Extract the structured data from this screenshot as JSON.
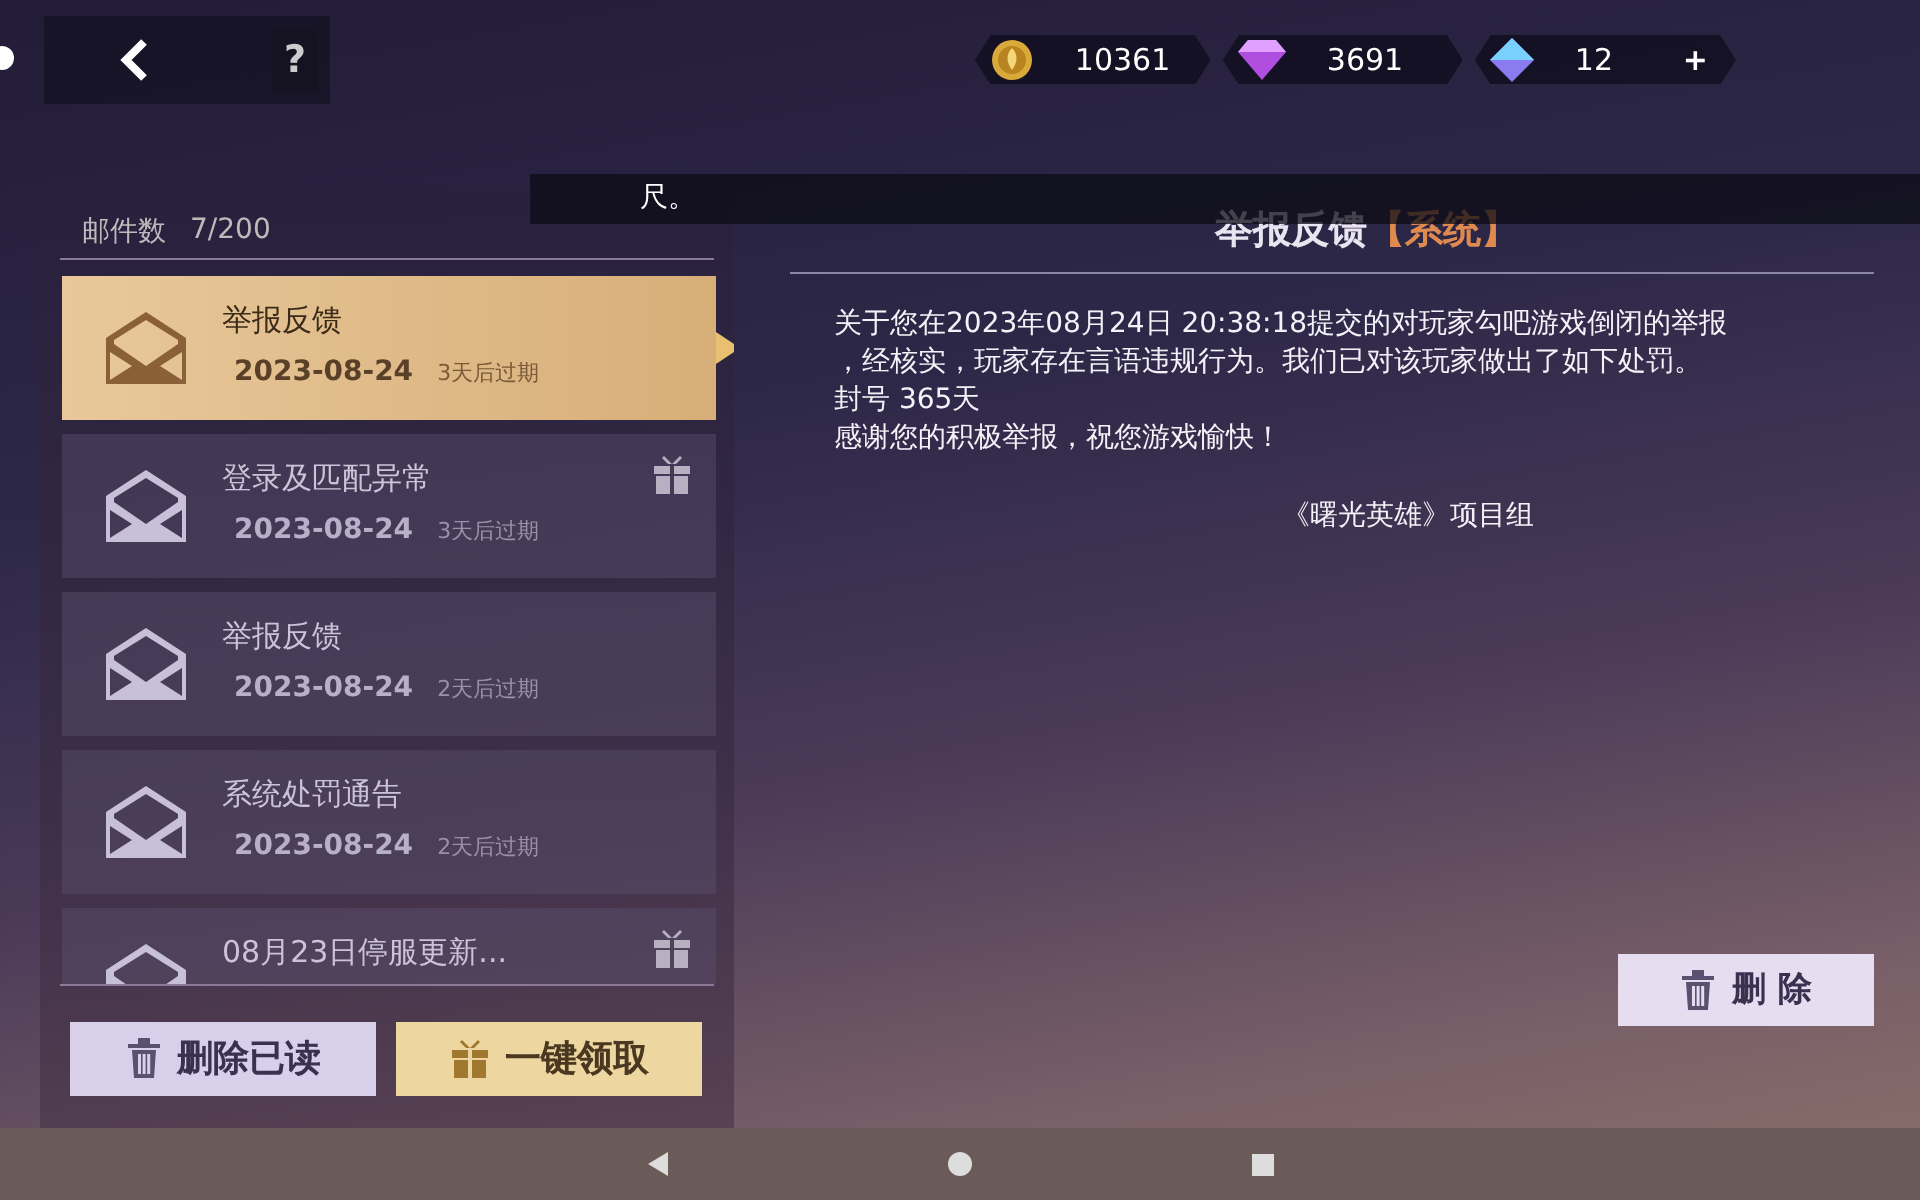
{
  "top_bar": {
    "help": "?",
    "currencies": [
      {
        "kind": "coin",
        "amount": "10361"
      },
      {
        "kind": "gem",
        "amount": "3691"
      },
      {
        "kind": "crystal",
        "amount": "12",
        "add": "+"
      }
    ]
  },
  "overlay_text": "尺。",
  "mail_panel": {
    "count_label": "邮件数",
    "count": "7/200",
    "mails": [
      {
        "title": "举报反馈",
        "date": "2023-08-24",
        "expiry": "3天后过期",
        "selected": true,
        "gift": false
      },
      {
        "title": "登录及匹配异常",
        "date": "2023-08-24",
        "expiry": "3天后过期",
        "selected": false,
        "gift": true
      },
      {
        "title": "举报反馈",
        "date": "2023-08-24",
        "expiry": "2天后过期",
        "selected": false,
        "gift": false
      },
      {
        "title": "系统处罚通告",
        "date": "2023-08-24",
        "expiry": "2天后过期",
        "selected": false,
        "gift": false
      },
      {
        "title": "08月23日停服更新...",
        "selected": false,
        "gift": true
      }
    ],
    "buttons": [
      {
        "kind": "delete",
        "label": "删除已读"
      },
      {
        "kind": "claim",
        "label": "一键领取"
      }
    ]
  },
  "detail": {
    "title": "举报反馈",
    "tag": "【系统】",
    "lines": [
      "关于您在2023年08月24日 20:38:18提交的对玩家勾吧游戏倒闭的举报",
      "，经核实，玩家存在言语违规行为。我们已对该玩家做出了如下处罚。",
      "封号 365天",
      "感谢您的积极举报，祝您游戏愉快！"
    ],
    "signature": "《曙光英雄》项目组",
    "delete_button": "删 除"
  }
}
